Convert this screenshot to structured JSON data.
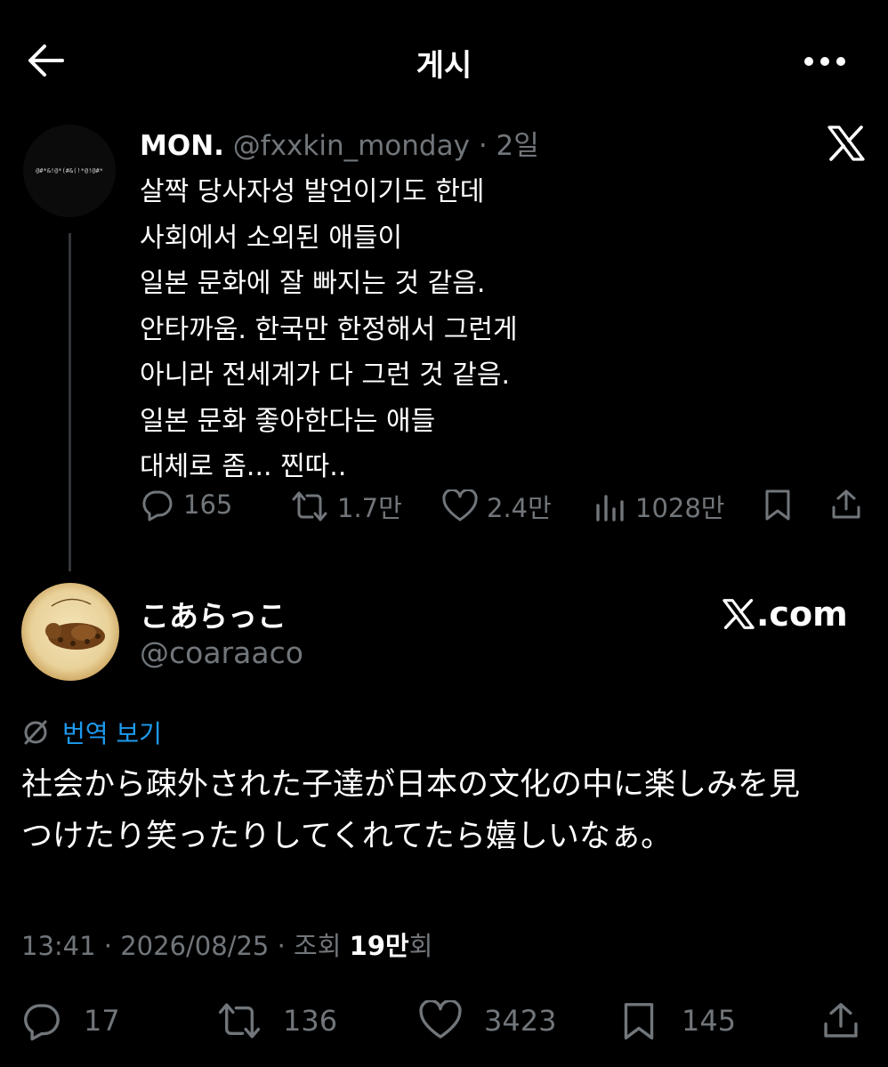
{
  "header": {
    "title": "게시"
  },
  "quoted_post": {
    "avatar_text": "@#*&!@*(#&(!*@!@#*",
    "name": "MON.",
    "handle": "@fxxkin_monday",
    "separator": "·",
    "time": "2일",
    "lines": [
      "살짝 당사자성 발언이기도 한데",
      "사회에서 소외된 애들이",
      "일본 문화에 잘 빠지는 것 같음.",
      "안타까움. 한국만 한정해서 그런게",
      "아니라 전세계가 다 그런 것 같음.",
      "일본 문화 좋아한다는 애들",
      "대체로 좀... 찐따.."
    ],
    "actions": {
      "replies": "165",
      "reposts": "1.7만",
      "likes": "2.4만",
      "views": "1028만"
    }
  },
  "main_post": {
    "name": "こあらっこ",
    "handle": "@coaraaco",
    "source_label": ".com",
    "translate_label": "번역 보기",
    "lines": [
      "社会から疎外された子達が日本の文化の中に楽しみを見",
      "つけたり笑ったりしてくれてたら嬉しいなぁ。"
    ],
    "meta": {
      "time": "13:41",
      "sep": "·",
      "date": "2026/08/25",
      "views_label": "조회",
      "views_count": "19만",
      "views_suffix": "회"
    },
    "actions": {
      "replies": "17",
      "reposts": "136",
      "likes": "3423",
      "bookmarks": "145"
    }
  },
  "icons": {
    "back": "arrow-left-icon",
    "more": "more-dots-icon",
    "x": "x-logo-icon",
    "reply": "reply-icon",
    "repost": "repost-icon",
    "like": "heart-icon",
    "views": "views-icon",
    "bookmark": "bookmark-icon",
    "share": "share-icon",
    "translate": "globe-slash-icon"
  },
  "colors": {
    "background": "#000000",
    "text": "#e7e9ea",
    "muted": "#71767b",
    "link": "#1d9bf0",
    "divider": "#333639"
  }
}
